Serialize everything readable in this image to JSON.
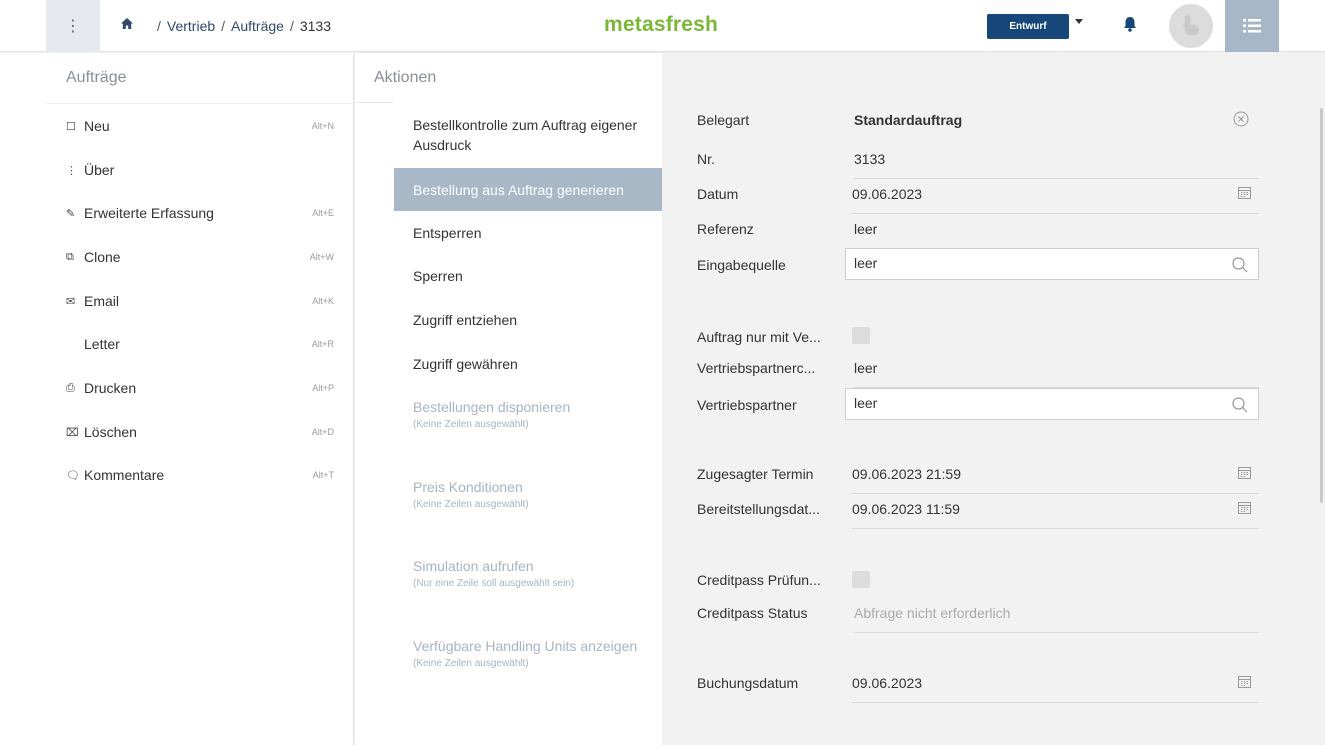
{
  "header": {
    "breadcrumb": [
      "Vertrieb",
      "Aufträge",
      "3133"
    ],
    "logo": "metasfresh",
    "status_label": "Entwurf"
  },
  "left_panel": {
    "title": "Aufträge",
    "items": [
      {
        "icon": "document-icon",
        "label": "Neu",
        "shortcut": "Alt+N"
      },
      {
        "icon": "more-vertical-icon",
        "label": "Über",
        "shortcut": ""
      },
      {
        "icon": "pencil-icon",
        "label": "Erweiterte Erfassung",
        "shortcut": "Alt+E"
      },
      {
        "icon": "clone-icon",
        "label": "Clone",
        "shortcut": "Alt+W"
      },
      {
        "icon": "email-icon",
        "label": "Email",
        "shortcut": "Alt+K"
      },
      {
        "icon": "",
        "label": "Letter",
        "shortcut": "Alt+R"
      },
      {
        "icon": "printer-icon",
        "label": "Drucken",
        "shortcut": "Alt+P"
      },
      {
        "icon": "delete-icon",
        "label": "Löschen",
        "shortcut": "Alt+D"
      },
      {
        "icon": "comment-icon",
        "label": "Kommentare",
        "shortcut": "Alt+T"
      }
    ]
  },
  "actions_panel": {
    "title": "Aktionen",
    "items": [
      {
        "label": "Bestellkontrolle zum Auftrag eigener Ausdruck",
        "sub": "",
        "state": "normal"
      },
      {
        "label": "Bestellung aus Auftrag generieren",
        "sub": "",
        "state": "active"
      },
      {
        "label": "Entsperren",
        "sub": "",
        "state": "normal"
      },
      {
        "label": "Sperren",
        "sub": "",
        "state": "normal"
      },
      {
        "label": "Zugriff entziehen",
        "sub": "",
        "state": "normal"
      },
      {
        "label": "Zugriff gewähren",
        "sub": "",
        "state": "normal"
      },
      {
        "label": "Bestellungen disponieren",
        "sub": "(Keine Zeilen ausgewählt)",
        "state": "disabled"
      },
      {
        "label": "Preis Konditionen",
        "sub": "(Keine Zeilen ausgewählt)",
        "state": "disabled"
      },
      {
        "label": "Simulation aufrufen",
        "sub": "(Nur eine Zeile soll ausgewählt sein)",
        "state": "disabled"
      },
      {
        "label": "Verfügbare Handling Units anzeigen",
        "sub": "(Keine Zeilen ausgewählt)",
        "state": "disabled"
      }
    ]
  },
  "form": {
    "belegart": {
      "label": "Belegart",
      "value": "Standardauftrag"
    },
    "nr": {
      "label": "Nr.",
      "value": "3133"
    },
    "datum": {
      "label": "Datum",
      "value": "09.06.2023"
    },
    "referenz": {
      "label": "Referenz",
      "value": "leer"
    },
    "eingabequelle": {
      "label": "Eingabequelle",
      "value": "leer"
    },
    "auftrag_nur": {
      "label": "Auftrag nur mit Ve..."
    },
    "vertriebspartnercode": {
      "label": "Vertriebspartnerc...",
      "value": "leer"
    },
    "vertriebspartner": {
      "label": "Vertriebspartner",
      "value": "leer"
    },
    "zugesagter_termin": {
      "label": "Zugesagter Termin",
      "value": "09.06.2023 21:59"
    },
    "bereitstellungsdatum": {
      "label": "Bereitstellungsdat...",
      "value": "09.06.2023 11:59"
    },
    "creditpass_pruefung": {
      "label": "Creditpass Prüfun..."
    },
    "creditpass_status": {
      "label": "Creditpass Status",
      "value": "Abfrage nicht erforderlich"
    },
    "buchungsdatum": {
      "label": "Buchungsdatum",
      "value": "09.06.2023"
    }
  }
}
